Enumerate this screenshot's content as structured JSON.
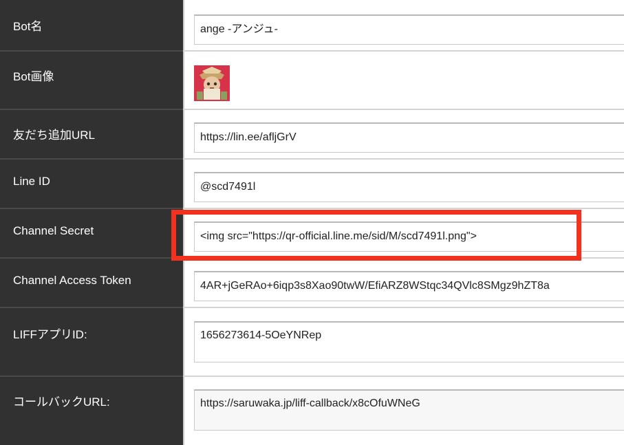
{
  "form": {
    "rows": [
      {
        "label": "Bot名",
        "value": "ange -アンジュ-"
      },
      {
        "label": "Bot画像",
        "image_alt": "bot-avatar"
      },
      {
        "label": "友だち追加URL",
        "value": "https://lin.ee/afljGrV"
      },
      {
        "label": "Line ID",
        "value": "@scd7491l"
      },
      {
        "label": "Channel Secret",
        "value": "<img src=\"https://qr-official.line.me/sid/M/scd7491l.png\">"
      },
      {
        "label": "Channel Access Token",
        "value": "4AR+jGeRAo+6iqp3s8Xao90twW/EfiARZ8WStqc34QVlc8SMgz9hZT8a"
      },
      {
        "label": "LIFFアプリID:",
        "value": "1656273614-5OeYNRep"
      },
      {
        "label": "コールバックURL:",
        "value": "https://saruwaka.jp/liff-callback/x8cOfuWNeG"
      }
    ]
  },
  "colors": {
    "label_bg": "#313131",
    "highlight": "#f2321f",
    "avatar_bg": "#d6324a"
  }
}
